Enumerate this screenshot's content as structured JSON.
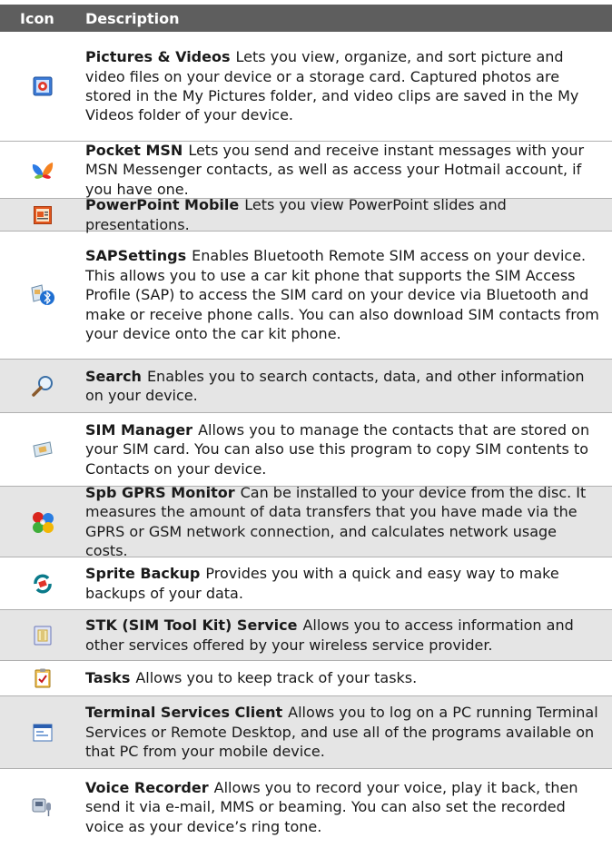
{
  "header": {
    "icon_label": "Icon",
    "description_label": "Description"
  },
  "rows": [
    {
      "icon": "pictures-videos-icon",
      "name": "Pictures & Videos",
      "text": "Lets you view, organize, and sort picture and video files on your device or a storage card. Captured photos are stored in the My Pictures folder, and video clips are saved in the My Videos folder of your device."
    },
    {
      "icon": "pocket-msn-butterfly-icon",
      "name": "Pocket MSN",
      "text": "Lets you send and receive instant messages with your MSN Messenger contacts, as well as access your Hotmail account, if you have one."
    },
    {
      "icon": "powerpoint-mobile-icon",
      "name": "PowerPoint Mobile",
      "text": "Lets you view PowerPoint slides and presentations."
    },
    {
      "icon": "sap-settings-bluetooth-icon",
      "name": "SAPSettings",
      "text": "Enables Bluetooth Remote SIM access on your device. This allows you to use a car kit phone that supports the SIM Access Profile (SAP) to access the SIM card on your device via Bluetooth and make or receive phone calls. You can also download SIM contacts from your device onto the car kit phone."
    },
    {
      "icon": "search-magnifier-icon",
      "name": "Search",
      "text": "Enables you to search contacts, data, and other information on your device."
    },
    {
      "icon": "sim-manager-icon",
      "name": "SIM Manager",
      "text": "Allows you to manage the contacts that are stored on your SIM card. You can also use this program to copy SIM contents to Contacts on your device."
    },
    {
      "icon": "spb-gprs-monitor-icon",
      "name": "Spb GPRS Monitor",
      "text": "Can be installed to your device from the disc. It measures the amount of data transfers that you have made via the GPRS or GSM network connection, and calculates network usage costs."
    },
    {
      "icon": "sprite-backup-icon",
      "name": "Sprite Backup",
      "text": "Provides you with a quick and easy way to make backups of your data."
    },
    {
      "icon": "stk-service-icon",
      "name": "STK (SIM Tool Kit) Service",
      "text": "Allows you to access information and other services offered by your wireless service provider."
    },
    {
      "icon": "tasks-clipboard-icon",
      "name": "Tasks",
      "text": "Allows you to keep track of your tasks."
    },
    {
      "icon": "terminal-services-client-icon",
      "name": "Terminal Services Client",
      "text": "Allows you to log on a PC running Terminal Services or Remote Desktop, and use all of the programs available on that PC from your mobile device."
    },
    {
      "icon": "voice-recorder-icon",
      "name": "Voice Recorder",
      "text": "Allows you to record your voice, play it back, then send it via e-mail, MMS or beaming. You can also set the recorded voice as your device’s ring tone."
    }
  ]
}
